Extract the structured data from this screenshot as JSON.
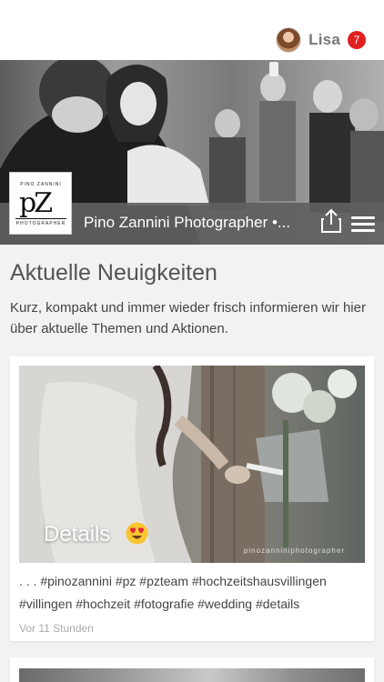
{
  "header": {
    "user_name": "Lisa",
    "notification_count": "7"
  },
  "hero": {
    "title": "Pino Zannini Photographer •...",
    "logo": {
      "top_text": "PINO ZANNINI",
      "mark": "pZ",
      "bottom_text": "PHOTOGRAPHER"
    }
  },
  "section": {
    "title": "Aktuelle Neuigkeiten",
    "description": "Kurz, kompakt und immer wieder frisch informieren wir hier über aktuelle Themen und Aktionen."
  },
  "posts": [
    {
      "caption": "Details",
      "watermark": "pinozanniniphotographer",
      "text": ". . . #pinozannini #pz #pzteam #hochzeitshausvillingen #villingen #hochzeit #fotografie #wedding #details",
      "time": "Vor 11 Stunden"
    }
  ],
  "colors": {
    "badge": "#e02020",
    "hero_bar": "#5f5f5f",
    "background": "#f2f2f2"
  }
}
